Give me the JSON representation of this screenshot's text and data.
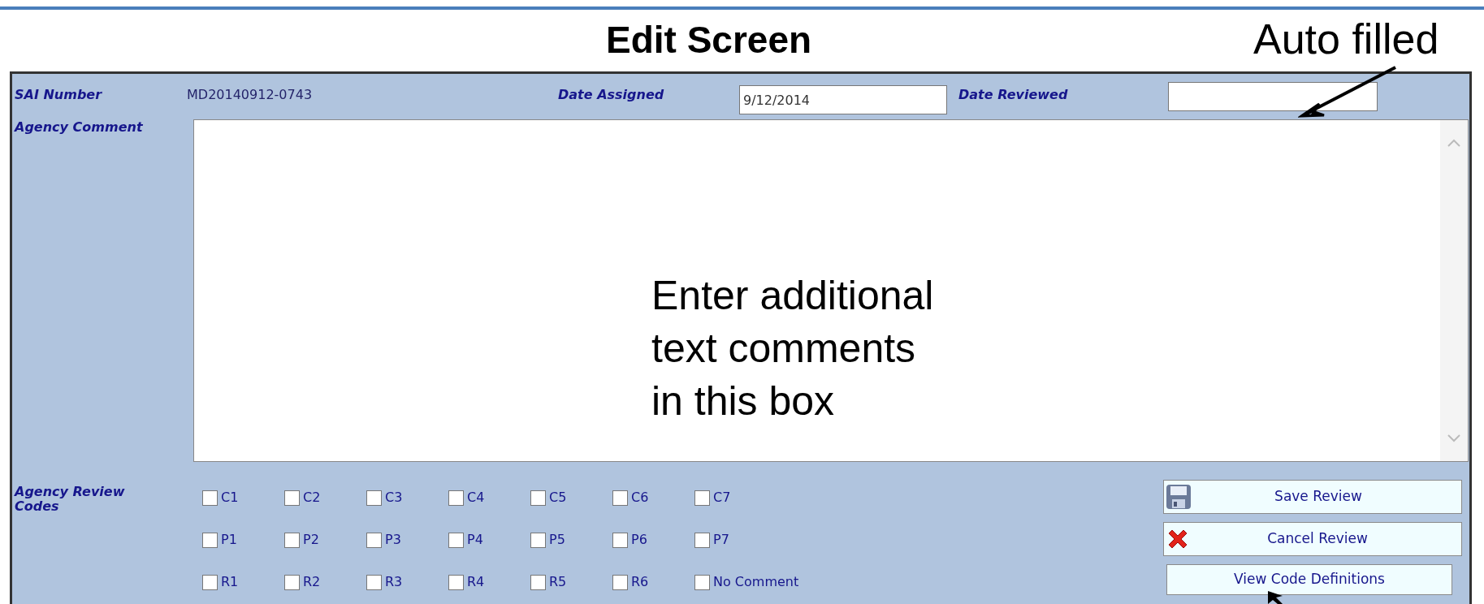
{
  "title": "Edit Screen",
  "annotations": {
    "auto_filled": "Auto filled",
    "comment_hint": "Enter additional\ntext comments\nin this box"
  },
  "form": {
    "sai_number": {
      "label": "SAI Number",
      "value": "MD20140912-0743"
    },
    "date_assigned": {
      "label": "Date Assigned",
      "value": "9/12/2014"
    },
    "date_reviewed": {
      "label": "Date Reviewed"
    },
    "agency_comment": {
      "label": "Agency Comment"
    },
    "review_codes": {
      "label": "Agency Review Codes",
      "rows": [
        [
          {
            "label": "C1",
            "checked": false
          },
          {
            "label": "C2",
            "checked": false
          },
          {
            "label": "C3",
            "checked": false
          },
          {
            "label": "C4",
            "checked": false
          },
          {
            "label": "C5",
            "checked": false
          },
          {
            "label": "C6",
            "checked": false
          },
          {
            "label": "C7",
            "checked": false
          }
        ],
        [
          {
            "label": "P1",
            "checked": false
          },
          {
            "label": "P2",
            "checked": false
          },
          {
            "label": "P3",
            "checked": false
          },
          {
            "label": "P4",
            "checked": false
          },
          {
            "label": "P5",
            "checked": false
          },
          {
            "label": "P6",
            "checked": false
          },
          {
            "label": "P7",
            "checked": false
          }
        ],
        [
          {
            "label": "R1",
            "checked": false
          },
          {
            "label": "R2",
            "checked": false
          },
          {
            "label": "R3",
            "checked": false
          },
          {
            "label": "R4",
            "checked": false
          },
          {
            "label": "R5",
            "checked": false
          },
          {
            "label": "R6",
            "checked": false
          },
          {
            "label": "No Comment",
            "checked": false
          }
        ]
      ]
    },
    "buttons": [
      {
        "label": "Save Review",
        "kind": "save"
      },
      {
        "label": "Cancel Review",
        "kind": "cancel"
      },
      {
        "label": "View Code Definitions",
        "kind": "plain"
      }
    ]
  }
}
